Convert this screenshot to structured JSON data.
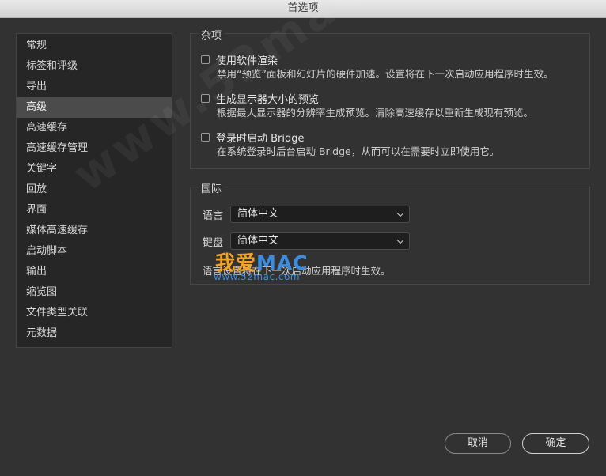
{
  "window": {
    "title": "首选项"
  },
  "sidebar": {
    "items": [
      {
        "label": "常规"
      },
      {
        "label": "标签和评级"
      },
      {
        "label": "导出"
      },
      {
        "label": "高级",
        "selected": true
      },
      {
        "label": "高速缓存"
      },
      {
        "label": "高速缓存管理"
      },
      {
        "label": "关键字"
      },
      {
        "label": "回放"
      },
      {
        "label": "界面"
      },
      {
        "label": "媒体高速缓存"
      },
      {
        "label": "启动脚本"
      },
      {
        "label": "输出"
      },
      {
        "label": "缩览图"
      },
      {
        "label": "文件类型关联"
      },
      {
        "label": "元数据"
      }
    ]
  },
  "misc": {
    "title": "杂项",
    "options": [
      {
        "title": "使用软件渲染",
        "desc": "禁用“预览”面板和幻灯片的硬件加速。设置将在下一次启动应用程序时生效。",
        "checked": false
      },
      {
        "title": "生成显示器大小的预览",
        "desc": "根据最大显示器的分辨率生成预览。清除高速缓存以重新生成现有预览。",
        "checked": false
      },
      {
        "title": "登录时启动 Bridge",
        "desc": "在系统登录时后台启动 Bridge，从而可以在需要时立即使用它。",
        "checked": false
      }
    ]
  },
  "intl": {
    "title": "国际",
    "language_label": "语言",
    "language_value": "简体中文",
    "keyboard_label": "键盘",
    "keyboard_value": "简体中文",
    "note": "语言设置将在下一次启动应用程序时生效。"
  },
  "footer": {
    "cancel_label": "取消",
    "ok_label": "确定"
  },
  "watermark": {
    "diagonal": "www.52mac.com",
    "logo_cn": "我爱",
    "logo_mac": "MAC",
    "logo_url": "www.52mac.com"
  },
  "colors": {
    "accent_orange": "#f2a224",
    "accent_blue": "#3c8de0"
  }
}
